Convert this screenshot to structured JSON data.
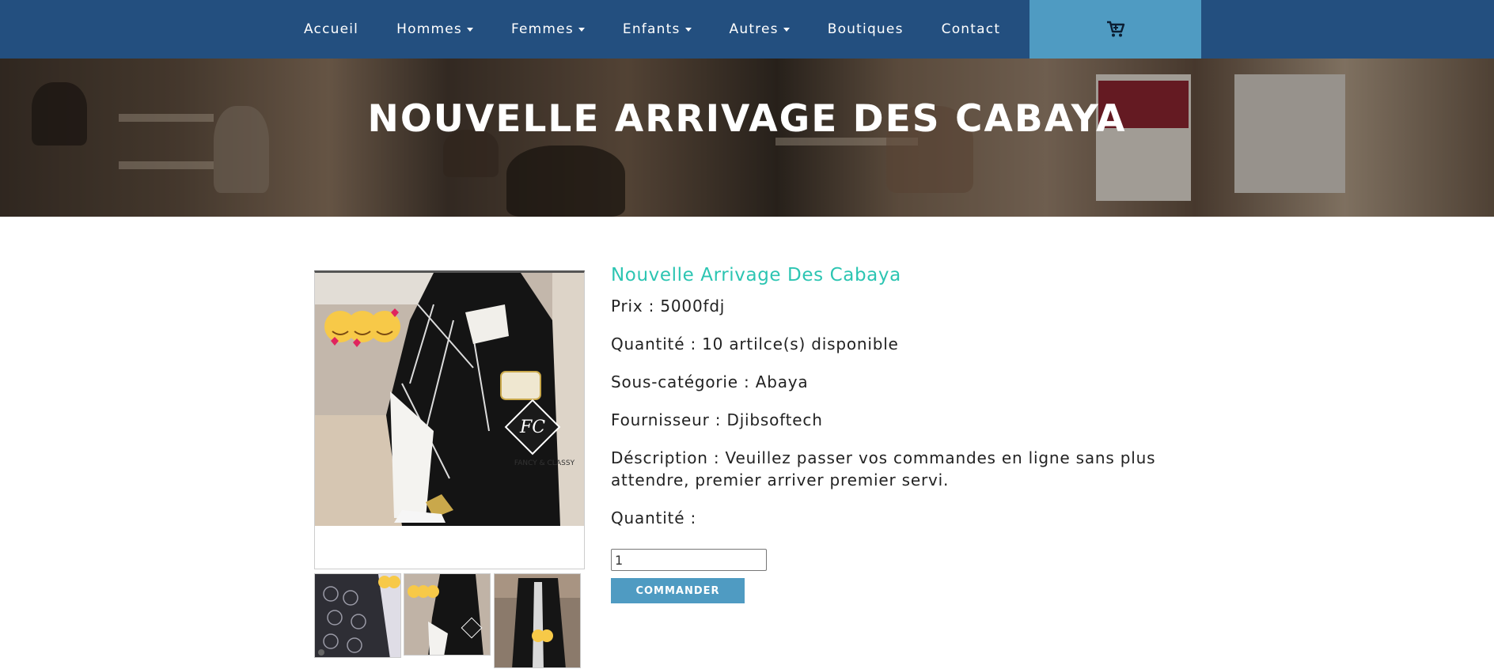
{
  "nav": {
    "items": [
      {
        "label": "Accueil",
        "dropdown": false
      },
      {
        "label": "Hommes",
        "dropdown": true
      },
      {
        "label": "Femmes",
        "dropdown": true
      },
      {
        "label": "Enfants",
        "dropdown": true
      },
      {
        "label": "Autres",
        "dropdown": true
      },
      {
        "label": "Boutiques",
        "dropdown": false
      },
      {
        "label": "Contact",
        "dropdown": false
      }
    ],
    "cart_icon": "cart-icon"
  },
  "hero": {
    "title": "NOUVELLE ARRIVAGE DES CABAYA"
  },
  "product": {
    "title": "Nouvelle Arrivage Des Cabaya",
    "price": "Prix : 5000fdj",
    "quantity_available": "Quantité : 10 artilce(s) disponible",
    "subcategory": "Sous-catégorie : Abaya",
    "supplier": "Fournisseur : Djibsoftech",
    "description": "Déscription : Veuillez passer vos commandes en ligne sans plus attendre, premier arriver premier servi.",
    "quantity_label": "Quantité :",
    "quantity_value": "1",
    "order_button": "COMMANDER",
    "image_logo_text": "FANCY & CLASSY"
  },
  "colors": {
    "navbar": "#234f7f",
    "cart_box": "#4f9bc2",
    "accent_title": "#2cc5b2",
    "button": "#4f9bc2"
  }
}
